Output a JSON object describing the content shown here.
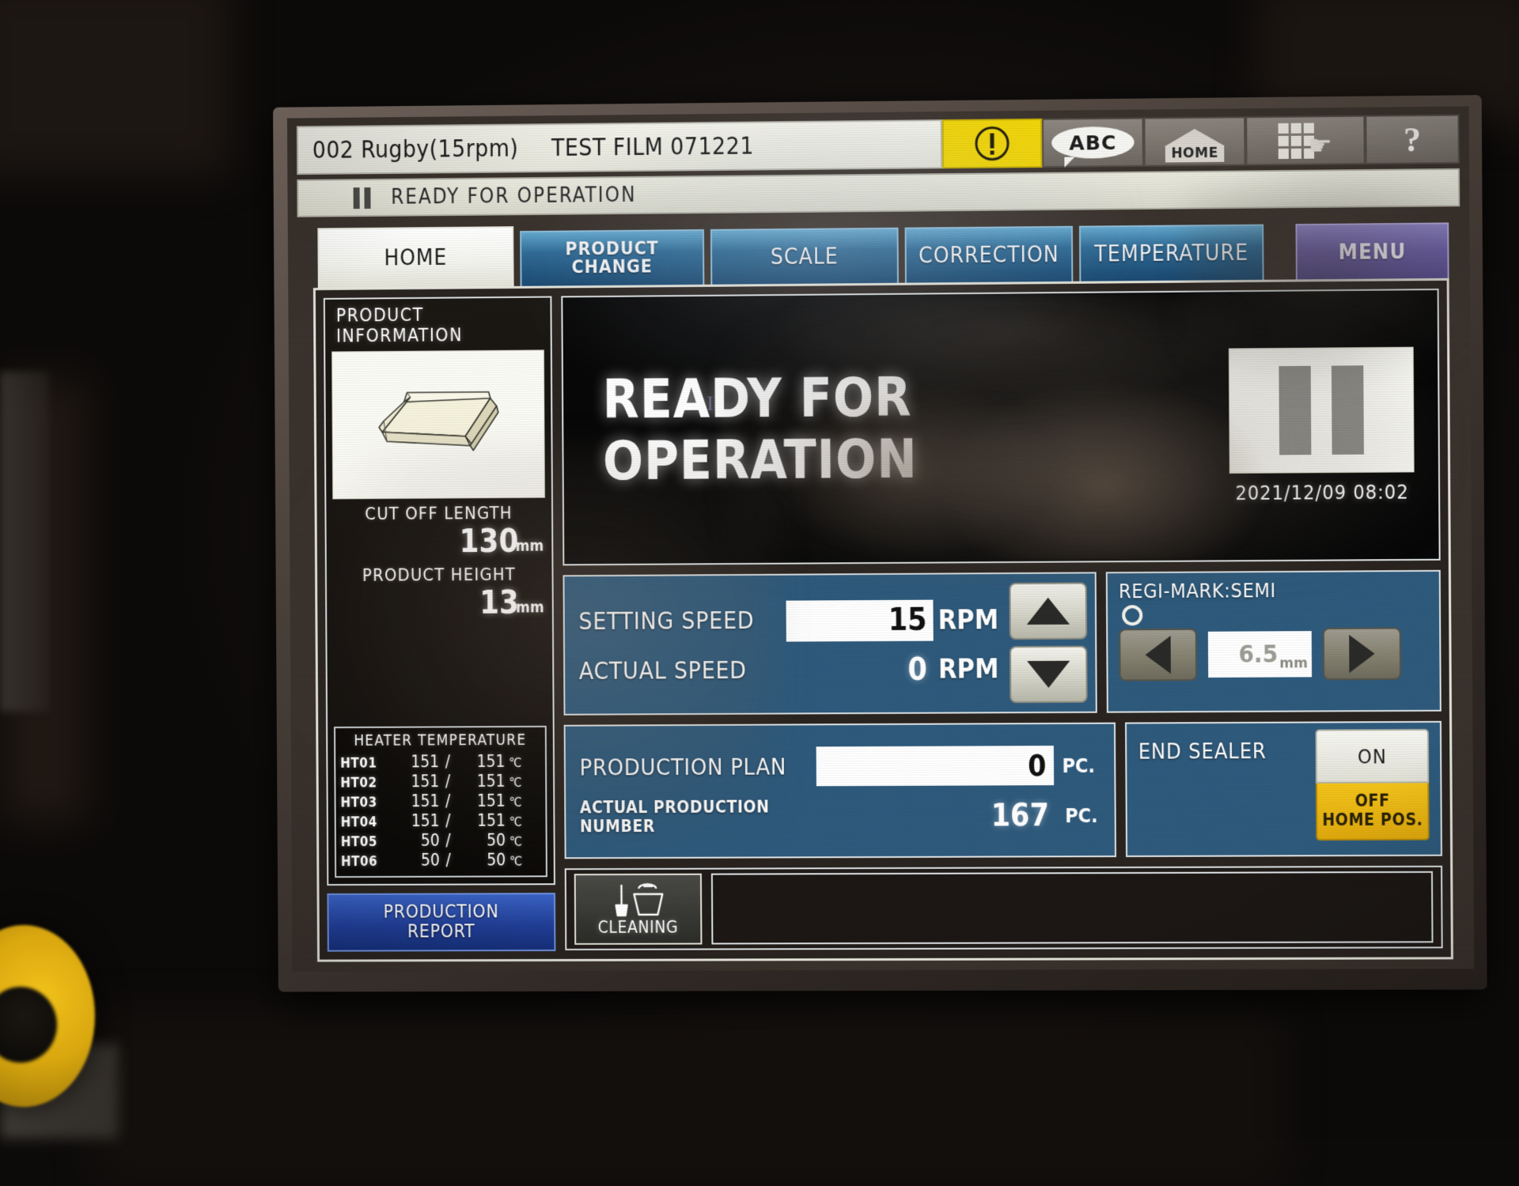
{
  "titlebar": {
    "product_code": "002 Rugby(15rpm)",
    "job_name": "TEST FILM 071221",
    "alert_icon": "alert-exclamation-icon",
    "abc_label": "ABC",
    "home_label": "HOME",
    "grid_icon": "grid-hand-icon",
    "help_label": "?"
  },
  "statusbar": {
    "pause_icon": "pause-icon",
    "text": "READY FOR OPERATION"
  },
  "tabs": [
    {
      "label": "HOME",
      "active": true
    },
    {
      "label": "PRODUCT",
      "label2": "CHANGE",
      "active": false
    },
    {
      "label": "SCALE",
      "active": false
    },
    {
      "label": "CORRECTION",
      "active": false
    },
    {
      "label": "TEMPERATURE",
      "active": false
    }
  ],
  "menu_button": "MENU",
  "product_information": {
    "title": "PRODUCT INFORMATION",
    "image_icon": "wrapped-package-icon",
    "cut_off_length_label": "CUT OFF LENGTH",
    "cut_off_length_value": "130",
    "cut_off_length_unit": "mm",
    "product_height_label": "PRODUCT HEIGHT",
    "product_height_value": "13",
    "product_height_unit": "mm",
    "heater_title": "HEATER TEMPERATURE",
    "heater_rows": [
      {
        "name": "HT01",
        "set": "151",
        "sep": "/",
        "actual": "151",
        "unit": "℃"
      },
      {
        "name": "HT02",
        "set": "151",
        "sep": "/",
        "actual": "151",
        "unit": "℃"
      },
      {
        "name": "HT03",
        "set": "151",
        "sep": "/",
        "actual": "151",
        "unit": "℃"
      },
      {
        "name": "HT04",
        "set": "151",
        "sep": "/",
        "actual": "151",
        "unit": "℃"
      },
      {
        "name": "HT05",
        "set": "50",
        "sep": "/",
        "actual": "50",
        "unit": "℃"
      },
      {
        "name": "HT06",
        "set": "50",
        "sep": "/",
        "actual": "50",
        "unit": "℃"
      }
    ]
  },
  "production_report_button": {
    "line1": "PRODUCTION",
    "line2": "REPORT"
  },
  "cleaning_button": {
    "label": "CLEANING",
    "icon": "cleaning-brush-bucket-icon"
  },
  "status_display": {
    "text": "READY FOR OPERATION",
    "machine_state_icon": "pause-icon",
    "datetime": "2021/12/09 08:02"
  },
  "speed_panel": {
    "setting_speed_label": "SETTING SPEED",
    "setting_speed_value": "15",
    "setting_speed_unit": "RPM",
    "actual_speed_label": "ACTUAL SPEED",
    "actual_speed_value": "0",
    "actual_speed_unit": "RPM",
    "up_icon": "arrow-up-icon",
    "down_icon": "arrow-down-icon"
  },
  "regi_mark_panel": {
    "title": "REGI-MARK:SEMI",
    "lamp_icon": "status-lamp-icon",
    "left_icon": "arrow-left-icon",
    "right_icon": "arrow-right-icon",
    "value": "6.5",
    "unit": "mm"
  },
  "production_panel": {
    "plan_label": "PRODUCTION PLAN",
    "plan_value": "0",
    "plan_unit": "PC.",
    "actual_label": "ACTUAL PRODUCTION NUMBER",
    "actual_value": "167",
    "actual_unit": "PC."
  },
  "end_sealer_panel": {
    "label": "END SEALER",
    "on_label": "ON",
    "off_label_line1": "OFF",
    "off_label_line2": "HOME POS.",
    "active": "off"
  },
  "colors": {
    "accent_blue": "#2e5a7c",
    "tab_blue": "#2f6b96",
    "menu_purple": "#6f62ab",
    "alert_yellow": "#f2d606",
    "off_yellow": "#e0a90d",
    "report_blue": "#22409a",
    "panel_border": "#dfe4e6"
  }
}
